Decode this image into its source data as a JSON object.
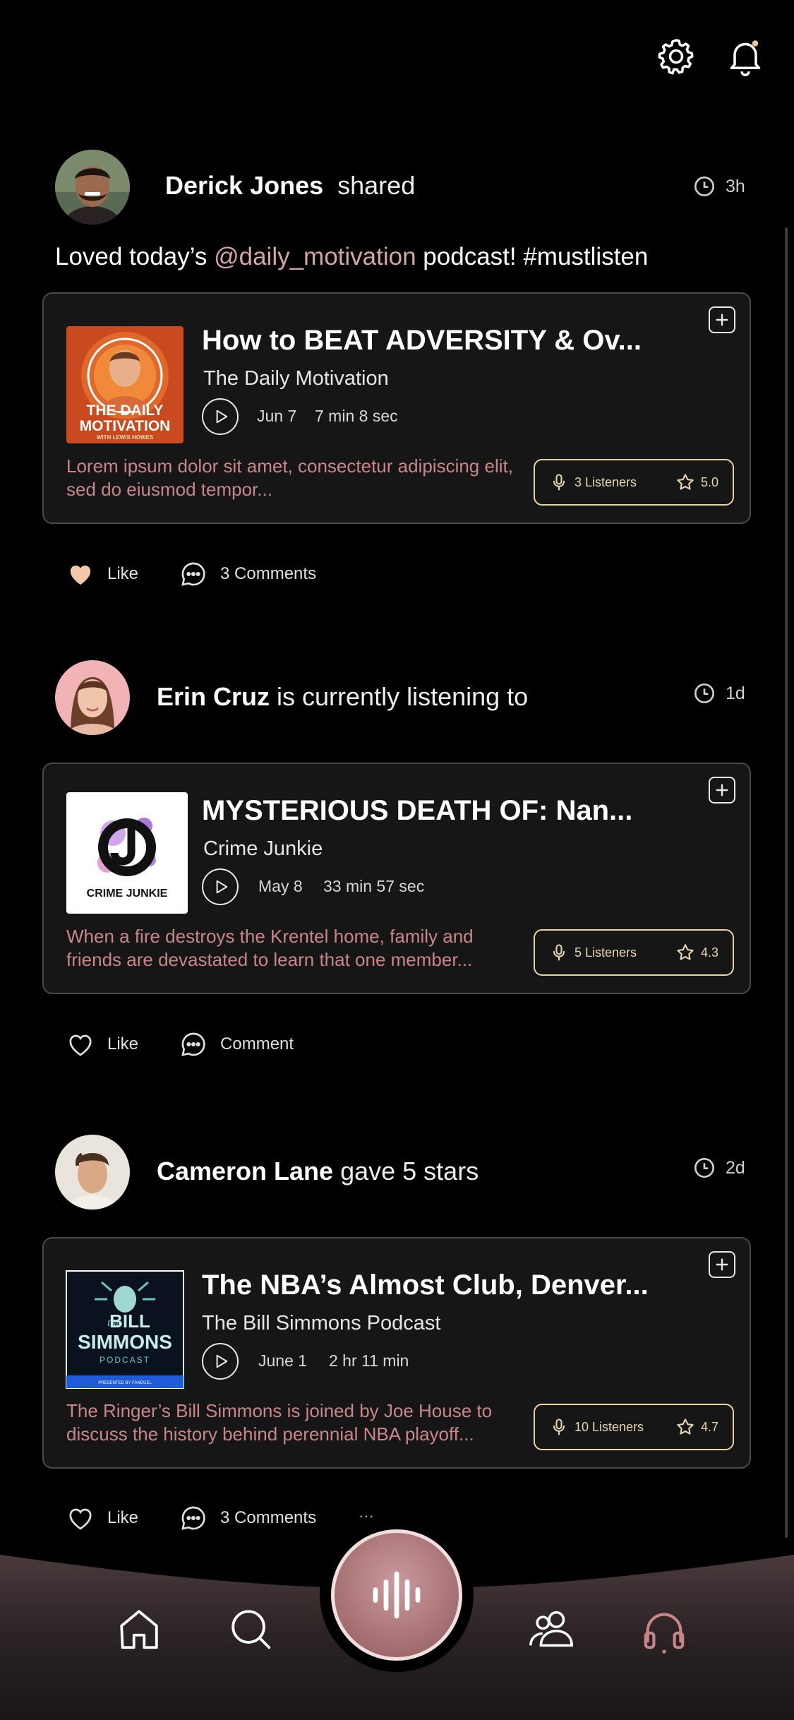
{
  "top_bar": {
    "settings_icon": "gear-icon",
    "notifications_icon": "bell-icon"
  },
  "feed": [
    {
      "user": "Derick Jones",
      "action": "shared",
      "time": "3h",
      "caption_before": "Loved today’s ",
      "caption_mention": "@daily_motivation",
      "caption_after": " podcast! #mustlisten",
      "episode_title": "How to BEAT ADVERSITY & Ov...",
      "show": "The Daily Motivation",
      "date": "Jun 7",
      "duration": "7 min 8 sec",
      "description": "Lorem ipsum dolor sit amet, consectetur adipiscing elit, sed do eiusmod tempor...",
      "listeners": "3 Listeners",
      "rating": "5.0",
      "like_label": "Like",
      "liked": true,
      "comment_label": "3 Comments",
      "cover": {
        "line1": "THE DAILY",
        "line2": "MOTIVATION",
        "line3": "WITH LEWIS HOWES"
      }
    },
    {
      "user": "Erin Cruz",
      "action": "is currently listening to",
      "time": "1d",
      "episode_title": "MYSTERIOUS DEATH OF: Nan...",
      "show": "Crime Junkie",
      "date": "May 8",
      "duration": "33 min 57 sec",
      "description": "When a fire destroys the Krentel home, family and friends are devastated to learn that one member...",
      "listeners": "5 Listeners",
      "rating": "4.3",
      "like_label": "Like",
      "liked": false,
      "comment_label": "Comment",
      "cover": {
        "line1": "CRIME JUNKIE"
      }
    },
    {
      "user": "Cameron Lane",
      "action": "gave 5 stars",
      "time": "2d",
      "episode_title": "The NBA’s Almost Club, Denver...",
      "show": "The Bill Simmons Podcast",
      "date": "June 1",
      "duration": "2 hr 11 min",
      "description": "The Ringer’s Bill Simmons is joined by Joe House to discuss the history behind perennial NBA playoff...",
      "listeners": "10 Listeners",
      "rating": "4.7",
      "like_label": "Like",
      "liked": false,
      "comment_label": "3 Comments",
      "cover": {
        "line1": "the",
        "line2": "BILL",
        "line3": "SIMMONS",
        "line4": "PODCAST",
        "line5": "PRESENTED BY FANDUEL"
      }
    }
  ],
  "more_indicator": "···",
  "bottom_nav": {
    "items": [
      "home-icon",
      "search-icon",
      "record-icon",
      "friends-icon",
      "headphones-icon"
    ],
    "active": "headphones-icon"
  },
  "colors": {
    "accent_pink": "#c9868a",
    "stats_gold": "#e9d4a4",
    "mention": "#d7a5a5"
  }
}
